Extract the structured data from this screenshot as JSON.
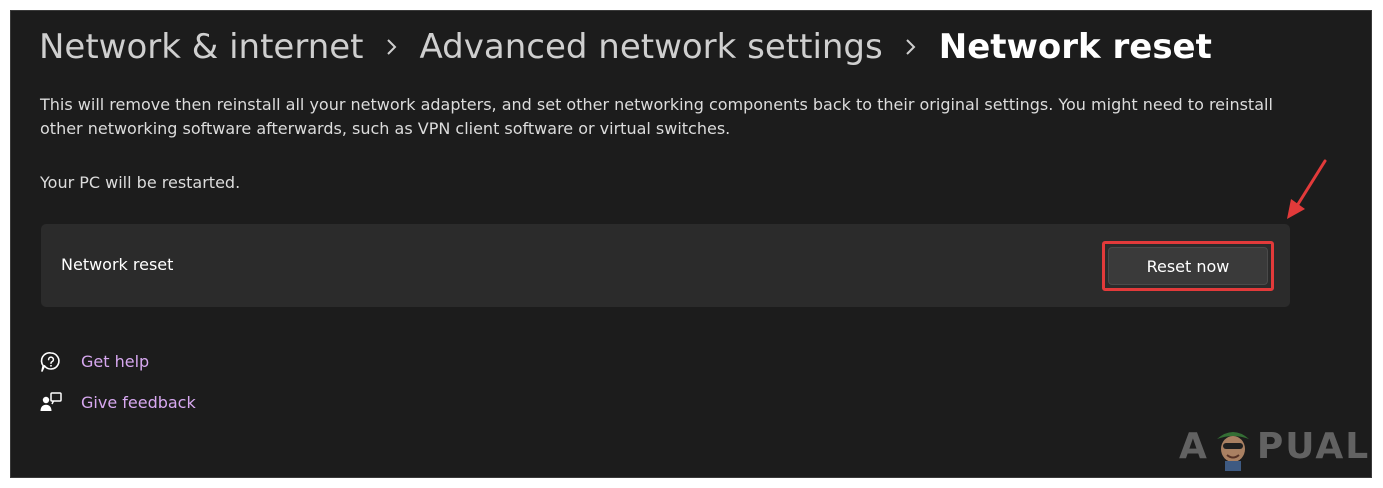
{
  "breadcrumb": {
    "items": [
      "Network & internet",
      "Advanced network settings"
    ],
    "current": "Network reset"
  },
  "description": "This will remove then reinstall all your network adapters, and set other networking components back to their original settings. You might need to reinstall other networking software afterwards, such as VPN client software or virtual switches.",
  "restart_note": "Your PC will be restarted.",
  "card": {
    "label": "Network reset",
    "button_label": "Reset now"
  },
  "links": {
    "help": {
      "label": "Get help",
      "icon": "help-chat-icon"
    },
    "feedback": {
      "label": "Give feedback",
      "icon": "feedback-icon"
    }
  },
  "watermark": {
    "prefix": "A",
    "suffix": "PUALS"
  },
  "colors": {
    "background": "#1c1c1c",
    "card": "#2b2b2b",
    "link": "#d7a8f0",
    "highlight": "#e23a3a"
  }
}
